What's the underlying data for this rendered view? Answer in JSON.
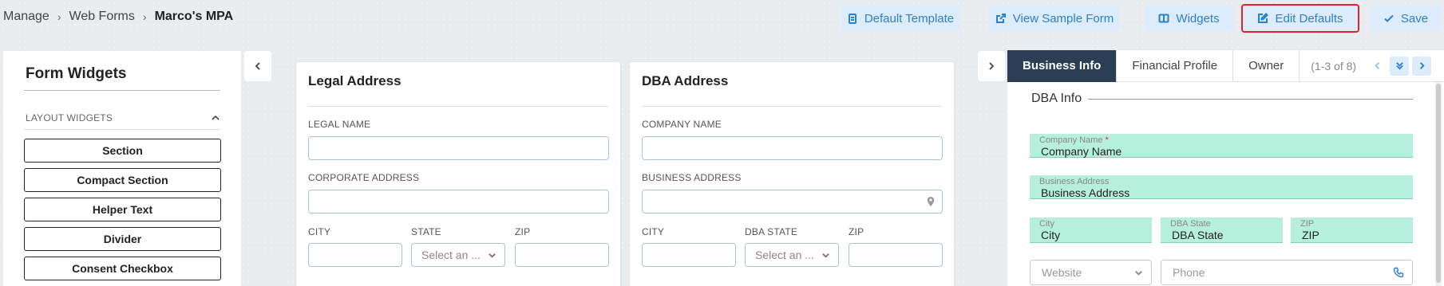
{
  "breadcrumb": {
    "items": [
      "Manage",
      "Web Forms"
    ],
    "current": "Marco's MPA"
  },
  "toolbar": {
    "default_template": "Default Template",
    "view_sample_form": "View Sample Form",
    "widgets": "Widgets",
    "edit_defaults": "Edit Defaults",
    "save": "Save"
  },
  "widgets_panel": {
    "title": "Form Widgets",
    "section_label": "LAYOUT WIDGETS",
    "items": [
      "Section",
      "Compact Section",
      "Helper Text",
      "Divider",
      "Consent Checkbox"
    ]
  },
  "legal_card": {
    "title": "Legal Address",
    "legal_name_label": "LEGAL NAME",
    "corporate_address_label": "CORPORATE ADDRESS",
    "city_label": "CITY",
    "state_label": "STATE",
    "state_placeholder": "Select an ...",
    "zip_label": "ZIP"
  },
  "dba_card": {
    "title": "DBA Address",
    "company_name_label": "COMPANY NAME",
    "business_address_label": "BUSINESS ADDRESS",
    "city_label": "CITY",
    "state_label": "DBA STATE",
    "state_placeholder": "Select an ...",
    "zip_label": "ZIP"
  },
  "preview": {
    "tabs": [
      "Business Info",
      "Financial Profile",
      "Owner"
    ],
    "active_tab": "Business Info",
    "pager_text": "(1-3 of 8)",
    "section_title": "DBA Info",
    "fields": {
      "company_name": {
        "label": "Company Name",
        "required_mark": "*",
        "value": "Company Name"
      },
      "business_address": {
        "label": "Business Address",
        "value": "Business Address"
      },
      "city": {
        "label": "City",
        "value": "City"
      },
      "dba_state": {
        "label": "DBA State",
        "value": "DBA State"
      },
      "zip": {
        "label": "ZIP",
        "value": "ZIP"
      },
      "website_placeholder": "Website",
      "phone_placeholder": "Phone"
    }
  },
  "colors": {
    "accent": "#2d7fd0",
    "button_bg": "#dcecfb",
    "highlight_border": "#e0242f",
    "active_tab": "#2c3e54",
    "preview_field": "#b6f0dc"
  }
}
